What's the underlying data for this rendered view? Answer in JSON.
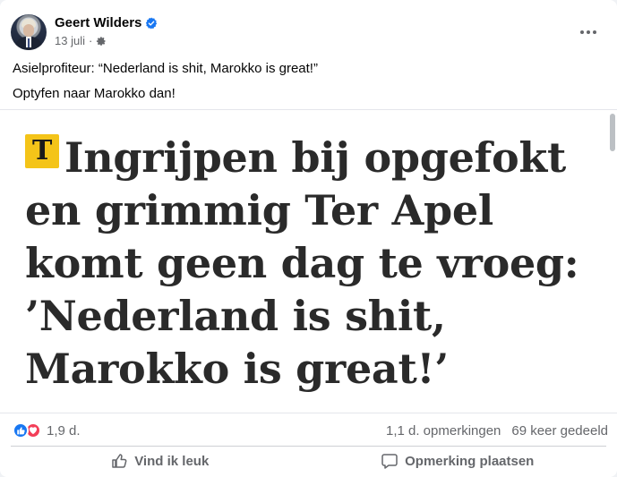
{
  "post": {
    "author": "Geert Wilders",
    "date": "13 juli",
    "separator": "·",
    "text_lines": [
      "Asielprofiteur: “Nederland is shit, Marokko is great!”",
      "Optyfen naar Marokko dan!"
    ],
    "image": {
      "logo_letter": "T",
      "headline_lines": [
        "Ingrijpen bij opgefokt",
        "en grimmig Ter Apel",
        "komt geen dag te vroeg:",
        "’Nederland is shit,",
        "Marokko is great!’"
      ]
    },
    "reactions_count": "1,9 d.",
    "comments_count": "1,1 d. opmerkingen",
    "shares_count": "69 keer gedeeld",
    "actions": {
      "like_label": "Vind ik leuk",
      "comment_label": "Opmerking plaatsen"
    }
  },
  "icons": {
    "verified": "verified-badge-icon",
    "audience": "gear-icon",
    "more": "more-options-icon",
    "like": "thumbs-up-icon",
    "comment": "comment-bubble-icon"
  },
  "colors": {
    "facebook_blue": "#1877f2",
    "love_red": "#f33e58",
    "telegraaf_yellow": "#f4c419",
    "secondary_text": "#65676b"
  }
}
